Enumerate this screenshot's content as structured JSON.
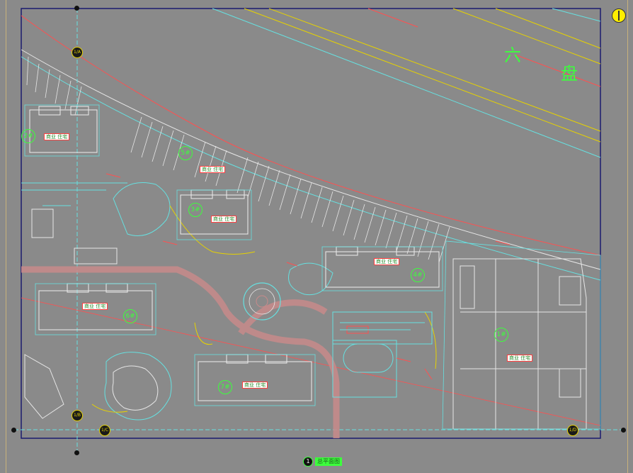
{
  "drawing": {
    "road_label_chars": [
      "六",
      "盘"
    ],
    "title_number": "1",
    "title_text": "总平面图",
    "north_marker": "north-arrow-icon",
    "building_numbers": [
      "2#",
      "5#",
      "3#",
      "4#",
      "6#",
      "7#",
      "1#"
    ],
    "building_tags": [
      "商业 住宅",
      "商业 住宅",
      "商业 住宅",
      "商业 住宅",
      "商业 住宅",
      "商业 住宅",
      "商业 住宅"
    ],
    "axis_bubbles": [
      "1/A",
      "1/B",
      "1/C",
      "1/D"
    ]
  },
  "colors": {
    "background": "#8a8a8a",
    "frame": "#c9b27a",
    "border_blue": "#1a1a6e",
    "cyan": "#66e0e0",
    "building_white": "#e6e6e6",
    "red": "#ff5050",
    "yellow": "#e6d200",
    "green_text": "#3cff3c",
    "paving": "#c88a8a"
  }
}
